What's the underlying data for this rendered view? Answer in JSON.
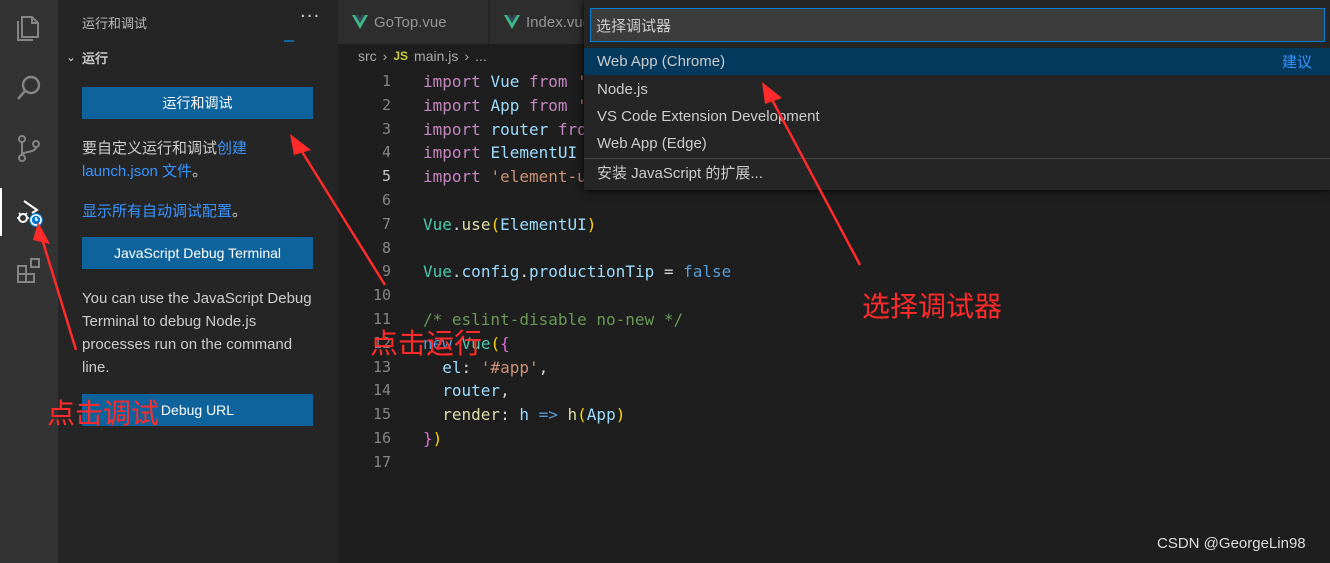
{
  "activity_bar": {
    "items": [
      "files-icon",
      "search-icon",
      "source-control-icon",
      "run-debug-icon",
      "extensions-icon"
    ]
  },
  "sidebar": {
    "title": "运行和调试",
    "more": "···",
    "section": "运行",
    "run_button": "运行和调试",
    "customize_prefix": "要自定义运行和调试",
    "customize_link_create": "创建",
    "customize_link_file": "launch.json 文件",
    "customize_suffix": "。",
    "show_all_link": "显示所有自动调试配置",
    "show_all_suffix": "。",
    "js_terminal_button": "JavaScript Debug Terminal",
    "help_text": "You can use the JavaScript Debug Terminal to debug Node.js processes run on the command line.",
    "debug_url_button": "Debug URL"
  },
  "tabs": [
    {
      "label": "GoTop.vue"
    },
    {
      "label": "Index.vue"
    }
  ],
  "breadcrumb": {
    "folder": "src",
    "badge": "JS",
    "file": "main.js",
    "ellipsis": "..."
  },
  "editor": {
    "line_numbers": [
      "1",
      "2",
      "3",
      "4",
      "5",
      "6",
      "7",
      "8",
      "9",
      "10",
      "11",
      "12",
      "13",
      "14",
      "15",
      "16",
      "17"
    ],
    "lines": [
      [
        {
          "c": "kw",
          "t": "import"
        },
        {
          "c": "",
          "t": " "
        },
        {
          "c": "id",
          "t": "Vue"
        },
        {
          "c": "",
          "t": " "
        },
        {
          "c": "kw",
          "t": "from"
        },
        {
          "c": "",
          "t": " "
        },
        {
          "c": "str",
          "t": "'"
        }
      ],
      [
        {
          "c": "kw",
          "t": "import"
        },
        {
          "c": "",
          "t": " "
        },
        {
          "c": "id",
          "t": "App"
        },
        {
          "c": "",
          "t": " "
        },
        {
          "c": "kw",
          "t": "from"
        },
        {
          "c": "",
          "t": " "
        },
        {
          "c": "str",
          "t": "'"
        }
      ],
      [
        {
          "c": "kw",
          "t": "import"
        },
        {
          "c": "",
          "t": " "
        },
        {
          "c": "id",
          "t": "router"
        },
        {
          "c": "",
          "t": " "
        },
        {
          "c": "kw",
          "t": "fro"
        }
      ],
      [
        {
          "c": "kw",
          "t": "import"
        },
        {
          "c": "",
          "t": " "
        },
        {
          "c": "id",
          "t": "ElementUI"
        }
      ],
      [
        {
          "c": "kw",
          "t": "import"
        },
        {
          "c": "",
          "t": " "
        },
        {
          "c": "str",
          "t": "'element-u"
        }
      ],
      [],
      [
        {
          "c": "ty",
          "t": "Vue"
        },
        {
          "c": "",
          "t": "."
        },
        {
          "c": "fn",
          "t": "use"
        },
        {
          "c": "br",
          "t": "("
        },
        {
          "c": "id",
          "t": "ElementUI"
        },
        {
          "c": "br",
          "t": ")"
        }
      ],
      [],
      [
        {
          "c": "ty",
          "t": "Vue"
        },
        {
          "c": "",
          "t": "."
        },
        {
          "c": "id",
          "t": "config"
        },
        {
          "c": "",
          "t": "."
        },
        {
          "c": "id",
          "t": "productionTip"
        },
        {
          "c": "",
          "t": " = "
        },
        {
          "c": "kw2",
          "t": "false"
        }
      ],
      [],
      [
        {
          "c": "cm",
          "t": "/* eslint-disable no-new */"
        }
      ],
      [
        {
          "c": "kw2",
          "t": "new"
        },
        {
          "c": "",
          "t": " "
        },
        {
          "c": "ty",
          "t": "Vue"
        },
        {
          "c": "br",
          "t": "("
        },
        {
          "c": "br2",
          "t": "{"
        }
      ],
      [
        {
          "c": "",
          "t": "  "
        },
        {
          "c": "id",
          "t": "el"
        },
        {
          "c": "",
          "t": ": "
        },
        {
          "c": "str",
          "t": "'#app'"
        },
        {
          "c": "",
          "t": ","
        }
      ],
      [
        {
          "c": "",
          "t": "  "
        },
        {
          "c": "id",
          "t": "router"
        },
        {
          "c": "",
          "t": ","
        }
      ],
      [
        {
          "c": "",
          "t": "  "
        },
        {
          "c": "fn",
          "t": "render"
        },
        {
          "c": "",
          "t": ": "
        },
        {
          "c": "id",
          "t": "h"
        },
        {
          "c": "",
          "t": " "
        },
        {
          "c": "kw2",
          "t": "=>"
        },
        {
          "c": "",
          "t": " "
        },
        {
          "c": "fn",
          "t": "h"
        },
        {
          "c": "br",
          "t": "("
        },
        {
          "c": "id",
          "t": "App"
        },
        {
          "c": "br",
          "t": ")"
        }
      ],
      [
        {
          "c": "br2",
          "t": "}"
        },
        {
          "c": "br",
          "t": ")"
        }
      ],
      []
    ]
  },
  "quick_pick": {
    "placeholder": "选择调试器",
    "items": [
      {
        "label": "Web App (Chrome)",
        "tag": "建议"
      },
      {
        "label": "Node.js",
        "tag": ""
      },
      {
        "label": "VS Code Extension Development",
        "tag": ""
      },
      {
        "label": "Web App (Edge)",
        "tag": ""
      },
      {
        "label": "安装 JavaScript 的扩展...",
        "tag": ""
      }
    ]
  },
  "annotations": {
    "click_run": "点击运行",
    "click_debug": "点击调试",
    "select_debugger": "选择调试器"
  },
  "watermark": "CSDN @GeorgeLin98",
  "colors": {
    "accent": "#0e639c",
    "link": "#3794ff",
    "annotation": "#ff2a2a"
  }
}
